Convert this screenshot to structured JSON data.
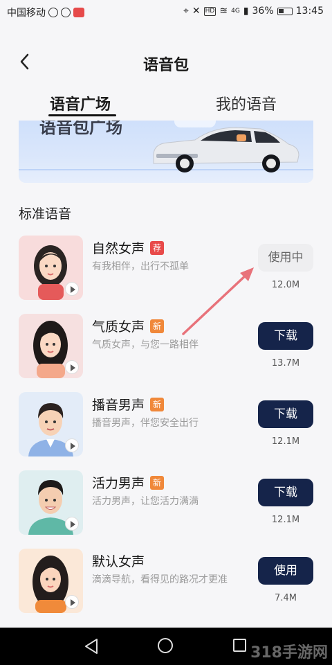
{
  "status_bar": {
    "carrier": "中国移动",
    "network": "4G",
    "battery": "36%",
    "time": "13:45"
  },
  "header": {
    "title": "语音包",
    "back_icon": "chevron-left-icon"
  },
  "tabs": [
    {
      "label": "语音广场",
      "active": true
    },
    {
      "label": "我的语音",
      "active": false
    }
  ],
  "banner": {
    "text": "语音包广场"
  },
  "section": {
    "title": "标准语音"
  },
  "voices": [
    {
      "name": "自然女声",
      "badge": "荐",
      "badge_color": "#e84a4a",
      "desc": "有我相伴，出行不孤单",
      "action": "使用中",
      "size": "12.0M"
    },
    {
      "name": "气质女声",
      "badge": "新",
      "badge_color": "#f0883a",
      "desc": "气质女声，与您一路相伴",
      "action": "下载",
      "size": "13.7M"
    },
    {
      "name": "播音男声",
      "badge": "新",
      "badge_color": "#f0883a",
      "desc": "播音男声，伴您安全出行",
      "action": "下载",
      "size": "12.1M"
    },
    {
      "name": "活力男声",
      "badge": "新",
      "badge_color": "#f0883a",
      "desc": "活力男声，让您活力满满",
      "action": "下载",
      "size": "12.1M"
    },
    {
      "name": "默认女声",
      "badge": "",
      "badge_color": "",
      "desc": "滴滴导航，看得见的路况才更准",
      "action": "使用",
      "size": "7.4M"
    }
  ],
  "watermark": "318手游网"
}
